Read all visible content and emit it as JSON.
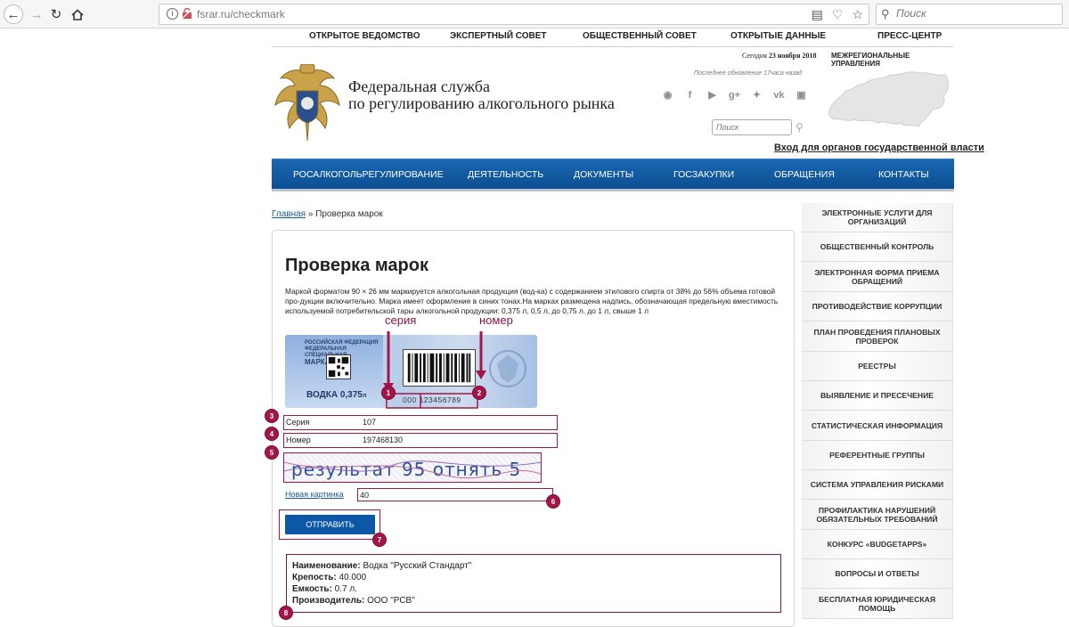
{
  "browser": {
    "url": "fsrar.ru/checkmark",
    "search_placeholder": "Поиск"
  },
  "topmenu": [
    "ОТКРЫТОЕ ВЕДОМСТВО",
    "ЭКСПЕРТНЫЙ СОВЕТ",
    "ОБЩЕСТВЕННЫЙ СОВЕТ",
    "ОТКРЫТЫЕ ДАННЫЕ",
    "ПРЕСС-ЦЕНТР"
  ],
  "header": {
    "title_line1": "Федеральная служба",
    "title_line2": "по регулированию алкогольного рынка",
    "date_prefix": "Сегодня",
    "date": "23 ноября 2018",
    "regional": "МЕЖРЕГИОНАЛЬНЫЕ УПРАВЛЕНИЯ",
    "updated": "Последнее обновление 17часа назад",
    "search_placeholder": "Поиск",
    "gov_login": "Вход для органов государственной власти"
  },
  "mainnav": [
    "РОСАЛКОГОЛЬРЕГУЛИРОВАНИЕ",
    "ДЕЯТЕЛЬНОСТЬ",
    "ДОКУМЕНТЫ",
    "ГОСЗАКУПКИ",
    "ОБРАЩЕНИЯ",
    "КОНТАКТЫ"
  ],
  "breadcrumb": {
    "home": "Главная",
    "separator": "»",
    "current": "Проверка марок"
  },
  "page": {
    "title": "Проверка марок",
    "description": "Маркой форматом 90 × 26 мм маркируется алкогольная продукция (вод-ка) с содержанием этилового спирта от 38% до 56% объема готовой про-дукции включительно. Марка имеет оформление в синих тонах.На марках размещена надпись, обозначающая предельную вместимость используемой потребительской тары алкогольной продукции: 0,375 л, 0,5 л, до 0,75 л, до 1 л, свыше 1 л"
  },
  "stamp": {
    "label_series": "серия",
    "label_number": "номер",
    "header_text_line1": "РОССИЙСКАЯ ФЕДЕРАЦИЯ",
    "header_text_line2": "ФЕДЕРАЛЬНАЯ",
    "header_text_line3": "СПЕЦИАЛЬНАЯ",
    "brand": "МАРКА",
    "vodka": "ВОДКА 0,375",
    "vodka_unit": "л",
    "series_code": "000",
    "number_code": "123456789"
  },
  "form": {
    "series_label": "Серия",
    "series_value": "107",
    "number_label": "Номер",
    "number_value": "197468130",
    "captcha_text": "результат 95 отнять 5 ...",
    "new_picture": "Новая картинка",
    "captcha_answer": "40",
    "submit_label": "ОТПРАВИТЬ"
  },
  "result": {
    "name_label": "Наименование:",
    "name_value": "Водка \"Русский Стандарт\"",
    "strength_label": "Крепость:",
    "strength_value": "40.000",
    "volume_label": "Емкость:",
    "volume_value": "0.7 л.",
    "producer_label": "Производитель:",
    "producer_value": "ООО \"РСВ\""
  },
  "badges": [
    "1",
    "2",
    "3",
    "4",
    "5",
    "6",
    "7",
    "8"
  ],
  "sidebar": [
    "ЭЛЕКТРОННЫЕ УСЛУГИ ДЛЯ ОРГАНИЗАЦИЙ",
    "ОБЩЕСТВЕННЫЙ КОНТРОЛЬ",
    "ЭЛЕКТРОННАЯ ФОРМА ПРИЕМА ОБРАЩЕНИЙ",
    "ПРОТИВОДЕЙСТВИЕ КОРРУПЦИИ",
    "ПЛАН ПРОВЕДЕНИЯ ПЛАНОВЫХ ПРОВЕРОК",
    "РЕЕСТРЫ",
    "ВЫЯВЛЕНИЕ И ПРЕСЕЧЕНИЕ",
    "СТАТИСТИЧЕСКАЯ ИНФОРМАЦИЯ",
    "РЕФЕРЕНТНЫЕ ГРУППЫ",
    "СИСТЕМА УПРАВЛЕНИЯ РИСКАМИ",
    "ПРОФИЛАКТИКА НАРУШЕНИЙ ОБЯЗАТЕЛЬНЫХ ТРЕБОВАНИЙ",
    "КОНКУРС «BUDGETAPPS»",
    "ВОПРОСЫ И ОТВЕТЫ",
    "БЕСПЛАТНАЯ ЮРИДИЧЕСКАЯ ПОМОЩЬ"
  ],
  "colors": {
    "accent_blue": "#0d58a6",
    "annotation": "#a4154a"
  }
}
